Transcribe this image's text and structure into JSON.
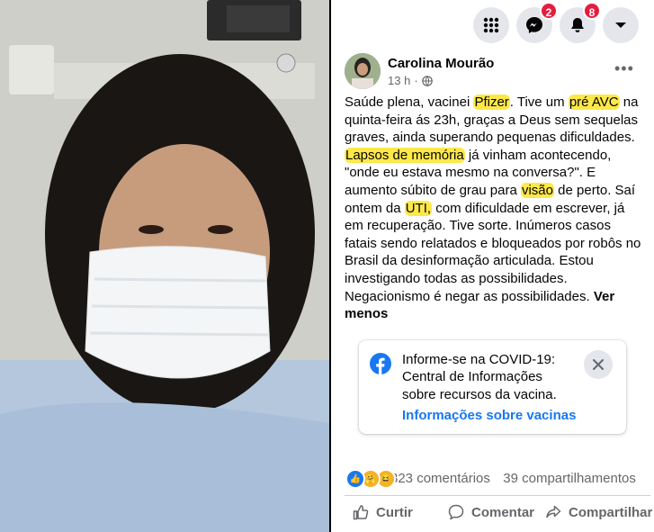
{
  "topbar": {
    "messenger_count": "2",
    "notifications_count": "8",
    "icons": [
      "menu-grid-icon",
      "messenger-icon",
      "bell-icon",
      "caret-down-icon"
    ]
  },
  "post": {
    "author": "Carolina Mourão",
    "time": "13 h",
    "dot": "·",
    "segments": [
      {
        "t": "Saúde plena, vacinei "
      },
      {
        "t": "Pfizer",
        "hl": true
      },
      {
        "t": ". Tive um "
      },
      {
        "t": "pré AVC",
        "hl": true
      },
      {
        "t": " na quinta-feira ás 23h, graças a Deus sem sequelas graves, ainda superando pequenas dificuldades. "
      },
      {
        "t": "Lapsos de memória",
        "hl": true
      },
      {
        "t": " já vinham acontecendo, \"onde eu estava mesmo na conversa?\". E aumento súbito de grau para "
      },
      {
        "t": "visão",
        "hl": true
      },
      {
        "t": " de perto. Saí ontem da "
      },
      {
        "t": "UTI,",
        "hl": true
      },
      {
        "t": " com dificuldade em escrever, já em recuperação. Tive sorte. Inúmeros casos fatais sendo relatados e bloqueados por robôs no Brasil da desinformação articulada. Estou investigando todas as possibilidades. Negacionismo é negar as possibilidades. "
      }
    ],
    "see_less": "Ver menos"
  },
  "info_card": {
    "text": "Informe-se na COVID-19: Central de Informações sobre recursos da vacina.",
    "link": "Informações sobre vacinas"
  },
  "stats": {
    "comments": "323 comentários",
    "shares": "39 compartilhamentos",
    "reaction_icons": [
      "like-icon",
      "care-icon",
      "haha-icon"
    ]
  },
  "actions": {
    "like": "Curtir",
    "comment": "Comentar",
    "share": "Compartilhar"
  },
  "colors": {
    "facebook_blue": "#1877f2",
    "highlight": "#fde84a",
    "badge_red": "#e41e3f"
  }
}
